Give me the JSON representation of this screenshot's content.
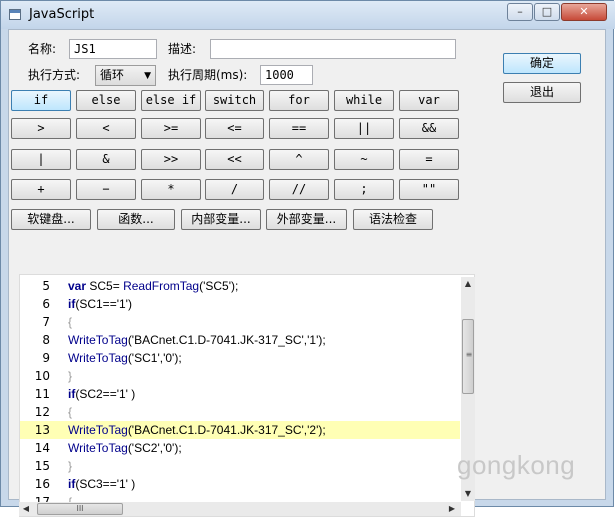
{
  "window": {
    "title": "JavaScript",
    "controls": {
      "minimize": "–",
      "maximize": "□",
      "close": "✕"
    }
  },
  "form": {
    "name_label": "名称:",
    "name_value": "JS1",
    "desc_label": "描述:",
    "desc_value": "",
    "mode_label": "执行方式:",
    "mode_value": "循环",
    "period_label": "执行周期(ms):",
    "period_value": "1000"
  },
  "actions": {
    "ok": "确定",
    "exit": "退出"
  },
  "keyword_buttons": [
    "if",
    "else",
    "else if",
    "switch",
    "for",
    "while",
    "var"
  ],
  "op_row1": [
    ">",
    "<",
    ">=",
    "<=",
    "==",
    "||",
    "&&"
  ],
  "op_row2": [
    "|",
    "&",
    ">>",
    "<<",
    "^",
    "~",
    "="
  ],
  "op_row3": [
    "+",
    "−",
    "*",
    "/",
    "//",
    ";",
    "\"\""
  ],
  "tool_buttons": [
    "软键盘...",
    "函数...",
    "内部变量...",
    "外部变量...",
    "语法检查"
  ],
  "code_lines": [
    {
      "num": "5",
      "indent": false,
      "highlight": false,
      "tokens": [
        {
          "t": "var",
          "c": "kw"
        },
        {
          "t": " SC5= ",
          "c": "plain"
        },
        {
          "t": "ReadFromTag",
          "c": "fn"
        },
        {
          "t": "('SC5');",
          "c": "plain"
        }
      ]
    },
    {
      "num": "6",
      "indent": false,
      "highlight": false,
      "tokens": [
        {
          "t": "if",
          "c": "kw"
        },
        {
          "t": "(SC1=='1')",
          "c": "plain"
        }
      ]
    },
    {
      "num": "7",
      "indent": false,
      "highlight": false,
      "tokens": [
        {
          "t": "{",
          "c": "brace"
        }
      ]
    },
    {
      "num": "8",
      "indent": false,
      "highlight": false,
      "tokens": [
        {
          "t": "WriteToTag",
          "c": "fn"
        },
        {
          "t": "('BACnet.C1.D-7041.JK-317_SC','1');",
          "c": "plain"
        }
      ]
    },
    {
      "num": "9",
      "indent": false,
      "highlight": false,
      "tokens": [
        {
          "t": "WriteToTag",
          "c": "fn"
        },
        {
          "t": "('SC1','0');",
          "c": "plain"
        }
      ]
    },
    {
      "num": "10",
      "indent": false,
      "highlight": false,
      "tokens": [
        {
          "t": "}",
          "c": "brace"
        }
      ]
    },
    {
      "num": "11",
      "indent": false,
      "highlight": false,
      "tokens": [
        {
          "t": "if",
          "c": "kw"
        },
        {
          "t": "(SC2=='1' )",
          "c": "plain"
        }
      ]
    },
    {
      "num": "12",
      "indent": false,
      "highlight": false,
      "tokens": [
        {
          "t": "{",
          "c": "brace"
        }
      ]
    },
    {
      "num": "13",
      "indent": false,
      "highlight": true,
      "tokens": [
        {
          "t": "WriteToTag",
          "c": "fn"
        },
        {
          "t": "('BACnet.C1.D-7041.JK-317_SC','2');",
          "c": "plain"
        }
      ]
    },
    {
      "num": "14",
      "indent": false,
      "highlight": false,
      "tokens": [
        {
          "t": "WriteToTag",
          "c": "fn"
        },
        {
          "t": "('SC2','0');",
          "c": "plain"
        }
      ]
    },
    {
      "num": "15",
      "indent": false,
      "highlight": false,
      "tokens": [
        {
          "t": "}",
          "c": "brace"
        }
      ]
    },
    {
      "num": "16",
      "indent": false,
      "highlight": false,
      "tokens": [
        {
          "t": "if",
          "c": "kw"
        },
        {
          "t": "(SC3=='1' )",
          "c": "plain"
        }
      ]
    },
    {
      "num": "17",
      "indent": false,
      "highlight": false,
      "tokens": [
        {
          "t": "{",
          "c": "brace"
        }
      ]
    }
  ],
  "scrollbar": {
    "up": "▲",
    "down": "▼",
    "left": "◀",
    "right": "▶",
    "grip": "≡",
    "hgrip": "III"
  },
  "watermark": "gongkong"
}
